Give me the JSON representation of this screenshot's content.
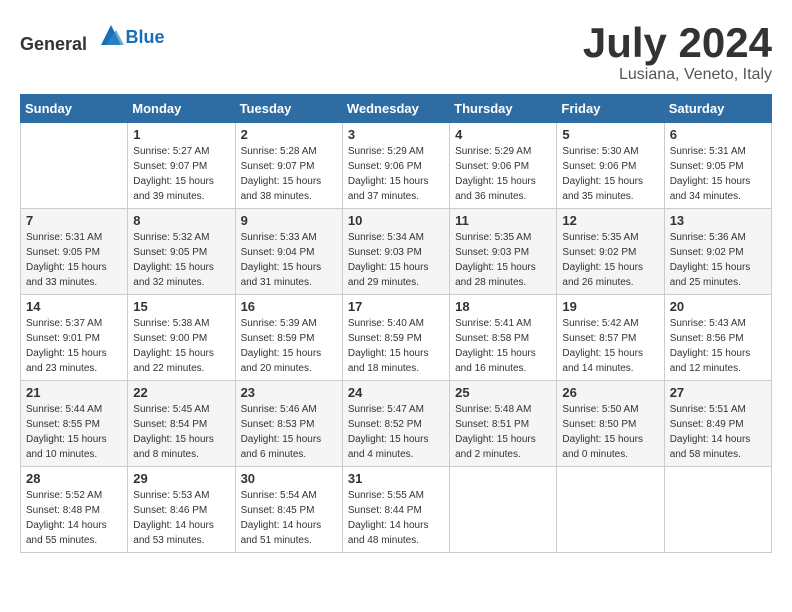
{
  "header": {
    "logo_general": "General",
    "logo_blue": "Blue",
    "title": "July 2024",
    "location": "Lusiana, Veneto, Italy"
  },
  "columns": [
    "Sunday",
    "Monday",
    "Tuesday",
    "Wednesday",
    "Thursday",
    "Friday",
    "Saturday"
  ],
  "weeks": [
    [
      {
        "day": "",
        "info": ""
      },
      {
        "day": "1",
        "info": "Sunrise: 5:27 AM\nSunset: 9:07 PM\nDaylight: 15 hours\nand 39 minutes."
      },
      {
        "day": "2",
        "info": "Sunrise: 5:28 AM\nSunset: 9:07 PM\nDaylight: 15 hours\nand 38 minutes."
      },
      {
        "day": "3",
        "info": "Sunrise: 5:29 AM\nSunset: 9:06 PM\nDaylight: 15 hours\nand 37 minutes."
      },
      {
        "day": "4",
        "info": "Sunrise: 5:29 AM\nSunset: 9:06 PM\nDaylight: 15 hours\nand 36 minutes."
      },
      {
        "day": "5",
        "info": "Sunrise: 5:30 AM\nSunset: 9:06 PM\nDaylight: 15 hours\nand 35 minutes."
      },
      {
        "day": "6",
        "info": "Sunrise: 5:31 AM\nSunset: 9:05 PM\nDaylight: 15 hours\nand 34 minutes."
      }
    ],
    [
      {
        "day": "7",
        "info": "Sunrise: 5:31 AM\nSunset: 9:05 PM\nDaylight: 15 hours\nand 33 minutes."
      },
      {
        "day": "8",
        "info": "Sunrise: 5:32 AM\nSunset: 9:05 PM\nDaylight: 15 hours\nand 32 minutes."
      },
      {
        "day": "9",
        "info": "Sunrise: 5:33 AM\nSunset: 9:04 PM\nDaylight: 15 hours\nand 31 minutes."
      },
      {
        "day": "10",
        "info": "Sunrise: 5:34 AM\nSunset: 9:03 PM\nDaylight: 15 hours\nand 29 minutes."
      },
      {
        "day": "11",
        "info": "Sunrise: 5:35 AM\nSunset: 9:03 PM\nDaylight: 15 hours\nand 28 minutes."
      },
      {
        "day": "12",
        "info": "Sunrise: 5:35 AM\nSunset: 9:02 PM\nDaylight: 15 hours\nand 26 minutes."
      },
      {
        "day": "13",
        "info": "Sunrise: 5:36 AM\nSunset: 9:02 PM\nDaylight: 15 hours\nand 25 minutes."
      }
    ],
    [
      {
        "day": "14",
        "info": "Sunrise: 5:37 AM\nSunset: 9:01 PM\nDaylight: 15 hours\nand 23 minutes."
      },
      {
        "day": "15",
        "info": "Sunrise: 5:38 AM\nSunset: 9:00 PM\nDaylight: 15 hours\nand 22 minutes."
      },
      {
        "day": "16",
        "info": "Sunrise: 5:39 AM\nSunset: 8:59 PM\nDaylight: 15 hours\nand 20 minutes."
      },
      {
        "day": "17",
        "info": "Sunrise: 5:40 AM\nSunset: 8:59 PM\nDaylight: 15 hours\nand 18 minutes."
      },
      {
        "day": "18",
        "info": "Sunrise: 5:41 AM\nSunset: 8:58 PM\nDaylight: 15 hours\nand 16 minutes."
      },
      {
        "day": "19",
        "info": "Sunrise: 5:42 AM\nSunset: 8:57 PM\nDaylight: 15 hours\nand 14 minutes."
      },
      {
        "day": "20",
        "info": "Sunrise: 5:43 AM\nSunset: 8:56 PM\nDaylight: 15 hours\nand 12 minutes."
      }
    ],
    [
      {
        "day": "21",
        "info": "Sunrise: 5:44 AM\nSunset: 8:55 PM\nDaylight: 15 hours\nand 10 minutes."
      },
      {
        "day": "22",
        "info": "Sunrise: 5:45 AM\nSunset: 8:54 PM\nDaylight: 15 hours\nand 8 minutes."
      },
      {
        "day": "23",
        "info": "Sunrise: 5:46 AM\nSunset: 8:53 PM\nDaylight: 15 hours\nand 6 minutes."
      },
      {
        "day": "24",
        "info": "Sunrise: 5:47 AM\nSunset: 8:52 PM\nDaylight: 15 hours\nand 4 minutes."
      },
      {
        "day": "25",
        "info": "Sunrise: 5:48 AM\nSunset: 8:51 PM\nDaylight: 15 hours\nand 2 minutes."
      },
      {
        "day": "26",
        "info": "Sunrise: 5:50 AM\nSunset: 8:50 PM\nDaylight: 15 hours\nand 0 minutes."
      },
      {
        "day": "27",
        "info": "Sunrise: 5:51 AM\nSunset: 8:49 PM\nDaylight: 14 hours\nand 58 minutes."
      }
    ],
    [
      {
        "day": "28",
        "info": "Sunrise: 5:52 AM\nSunset: 8:48 PM\nDaylight: 14 hours\nand 55 minutes."
      },
      {
        "day": "29",
        "info": "Sunrise: 5:53 AM\nSunset: 8:46 PM\nDaylight: 14 hours\nand 53 minutes."
      },
      {
        "day": "30",
        "info": "Sunrise: 5:54 AM\nSunset: 8:45 PM\nDaylight: 14 hours\nand 51 minutes."
      },
      {
        "day": "31",
        "info": "Sunrise: 5:55 AM\nSunset: 8:44 PM\nDaylight: 14 hours\nand 48 minutes."
      },
      {
        "day": "",
        "info": ""
      },
      {
        "day": "",
        "info": ""
      },
      {
        "day": "",
        "info": ""
      }
    ]
  ]
}
